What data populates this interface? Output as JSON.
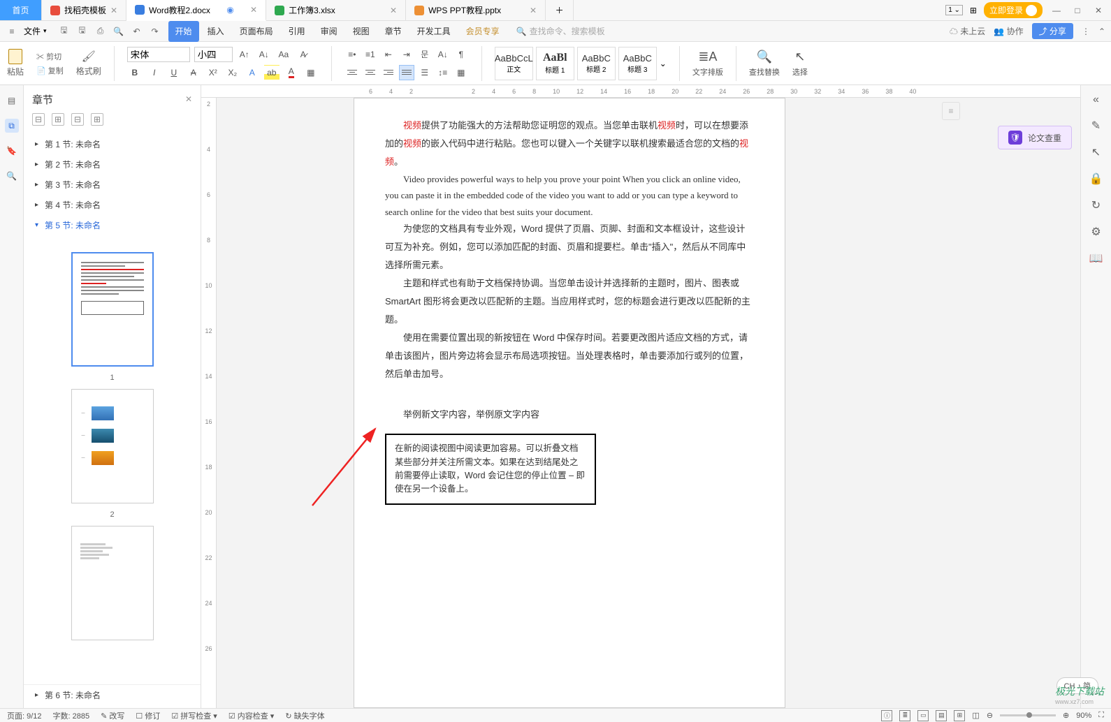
{
  "tabs": {
    "home": "首页",
    "items": [
      {
        "label": "找稻壳模板",
        "icon": "red"
      },
      {
        "label": "Word教程2.docx",
        "icon": "blue",
        "active": true
      },
      {
        "label": "工作簿3.xlsx",
        "icon": "green"
      },
      {
        "label": "WPS PPT教程.pptx",
        "icon": "orange"
      }
    ]
  },
  "title_right": {
    "login": "立即登录"
  },
  "menu": {
    "file": "文件",
    "items": [
      "开始",
      "插入",
      "页面布局",
      "引用",
      "审阅",
      "视图",
      "章节",
      "开发工具",
      "会员专享"
    ],
    "active": "开始",
    "search_placeholder": "查找命令、搜索模板",
    "cloud": "未上云",
    "coop": "协作",
    "share": "分享"
  },
  "ribbon": {
    "paste": "粘贴",
    "cut": "剪切",
    "copy": "复制",
    "format_painter": "格式刷",
    "font_name": "宋体",
    "font_size": "小四",
    "styles": [
      {
        "preview": "AaBbCcL",
        "name": "正文"
      },
      {
        "preview": "AaBl",
        "name": "标题 1",
        "big": true
      },
      {
        "preview": "AaBbC",
        "name": "标题 2"
      },
      {
        "preview": "AaBbC",
        "name": "标题 3"
      }
    ],
    "text_layout": "文字排版",
    "find_replace": "查找替换",
    "select": "选择"
  },
  "nav": {
    "title": "章节",
    "sections": [
      {
        "label": "第 1 节: 未命名"
      },
      {
        "label": "第 2 节: 未命名"
      },
      {
        "label": "第 3 节: 未命名"
      },
      {
        "label": "第 4 节: 未命名"
      },
      {
        "label": "第 5 节: 未命名",
        "active": true,
        "expanded": true
      },
      {
        "label": "第 6 节: 未命名",
        "bottom": true
      }
    ],
    "thumb_nums": [
      "1",
      "2"
    ]
  },
  "hruler_marks": [
    "6",
    "4",
    "2",
    "2",
    "4",
    "6",
    "8",
    "10",
    "12",
    "14",
    "16",
    "18",
    "20",
    "22",
    "24",
    "26",
    "28",
    "30",
    "32",
    "34",
    "36",
    "38",
    "40"
  ],
  "vruler_marks": [
    "2",
    "4",
    "6",
    "8",
    "10",
    "12",
    "14",
    "16",
    "18",
    "20",
    "22",
    "24",
    "26"
  ],
  "doc": {
    "p1_a": "视频",
    "p1_b": "提供了功能强大的方法帮助您证明您的观点。当您单击联机",
    "p1_c": "视频",
    "p1_d": "时，可以在想要添加的",
    "p1_e": "视频",
    "p1_f": "的嵌入代码中进行粘贴。您也可以键入一个关键字以联机搜索最适合您的文档的",
    "p1_g": "视频",
    "p1_h": "。",
    "p2": "Video provides powerful ways to help you prove your point When you click an online video, you can paste it in the embedded code of the video you want to add or you can type a keyword to search online for the video that best suits your document.",
    "p3": "为使您的文档具有专业外观，Word 提供了页眉、页脚、封面和文本框设计，这些设计可互为补充。例如，您可以添加匹配的封面、页眉和提要栏。单击\"插入\"，然后从不同库中选择所需元素。",
    "p4": "主题和样式也有助于文档保持协调。当您单击设计并选择新的主题时，图片、图表或 SmartArt 图形将会更改以匹配新的主题。当应用样式时，您的标题会进行更改以匹配新的主题。",
    "p5": "使用在需要位置出现的新按钮在 Word 中保存时间。若要更改图片适应文档的方式，请单击该图片，图片旁边将会显示布局选项按钮。当处理表格时，单击要添加行或列的位置，然后单击加号。",
    "caption": "举例新文字内容，举例原文字内容",
    "box": "在新的阅读视图中阅读更加容易。可以折叠文档某些部分并关注所需文本。如果在达到结尾处之前需要停止读取，Word 会记住您的停止位置 – 即使在另一个设备上。"
  },
  "side_tool": {
    "check": "论文查重"
  },
  "status": {
    "page": "页面: 9/12",
    "words": "字数: 2885",
    "corrections": "改写",
    "revisions": "修订",
    "spell": "拼写检查",
    "content": "内容检查",
    "missing": "缺失字体",
    "zoom": "90%"
  },
  "ime": {
    "label": "CH ♪ 简"
  },
  "watermark": {
    "main": "极光下载站",
    "sub": "www.xz7.com"
  }
}
